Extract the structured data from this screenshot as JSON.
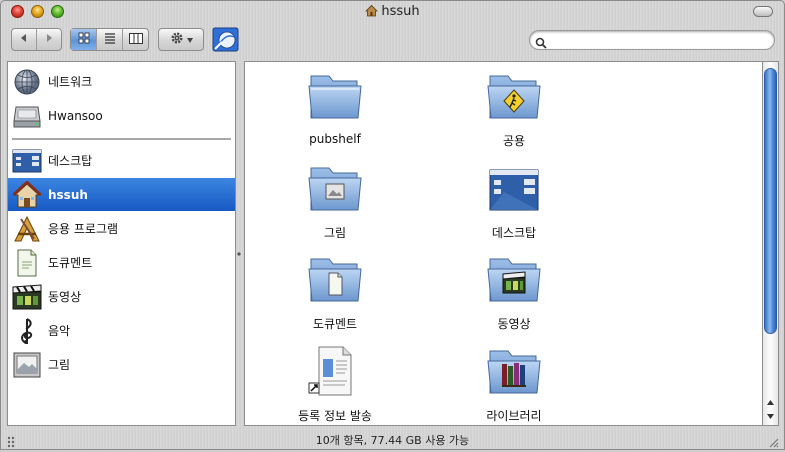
{
  "window": {
    "title": "hssuh"
  },
  "toolbar": {
    "back_icon": "back-arrow-icon",
    "forward_icon": "forward-arrow-icon",
    "view_modes": [
      "icon-view-icon",
      "list-view-icon",
      "column-view-icon"
    ],
    "active_view": "icon-view",
    "action_icon": "gear-icon",
    "search": {
      "value": "",
      "placeholder": ""
    }
  },
  "sidebar": {
    "devices": [
      {
        "label": "네트워크",
        "icon": "network-globe-icon"
      },
      {
        "label": "Hwansoo",
        "icon": "hard-disk-icon"
      }
    ],
    "places": [
      {
        "label": "데스크탑",
        "icon": "desktop-icon"
      },
      {
        "label": "hssuh",
        "icon": "home-icon",
        "selected": true
      },
      {
        "label": "응용 프로그램",
        "icon": "applications-icon"
      },
      {
        "label": "도큐멘트",
        "icon": "documents-icon"
      },
      {
        "label": "동영상",
        "icon": "movies-icon"
      },
      {
        "label": "음악",
        "icon": "music-icon"
      },
      {
        "label": "그림",
        "icon": "pictures-icon"
      }
    ]
  },
  "content": {
    "items": [
      {
        "label": "pubshelf",
        "icon": "folder-icon"
      },
      {
        "label": "공용",
        "icon": "public-folder-icon"
      },
      {
        "label": "그림",
        "icon": "pictures-folder-icon"
      },
      {
        "label": "데스크탑",
        "icon": "desktop-folder-icon"
      },
      {
        "label": "도큐멘트",
        "icon": "documents-folder-icon"
      },
      {
        "label": "동영상",
        "icon": "movies-folder-icon"
      },
      {
        "label": "등록 정보 발송",
        "icon": "alias-document-icon"
      },
      {
        "label": "라이브러리",
        "icon": "library-folder-icon"
      }
    ]
  },
  "status": {
    "text": "10개 항목, 77.44 GB 사용 가능"
  },
  "colors": {
    "selection": "#1f63cc",
    "folder_blue": "#7fa9dd",
    "scroll_thumb": "#4c8ad8"
  }
}
